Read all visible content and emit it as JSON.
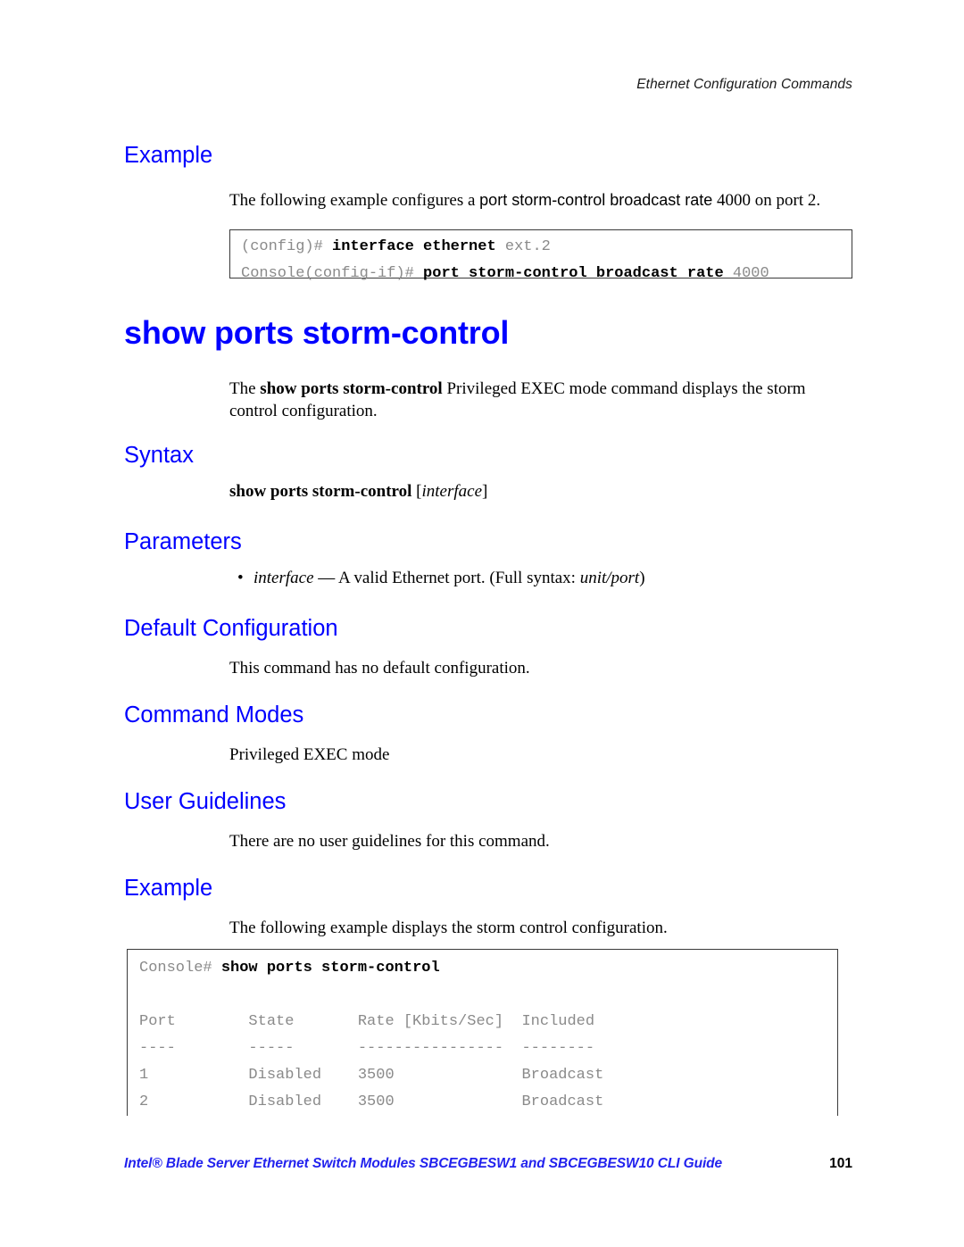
{
  "header": {
    "running_title": "Ethernet Configuration Commands"
  },
  "top_section": {
    "heading": "Example",
    "paragraph_prefix": "The following example configures a ",
    "paragraph_command": "port storm-control broadcast rate",
    "paragraph_suffix": " 4000 on port 2.",
    "code_block": {
      "line1_prompt": "(config)# ",
      "line1_command": "interface ethernet",
      "line1_arg": " ext.2",
      "line2_prompt": "Console(config-if)# ",
      "line2_command": "port storm-control broadcast rate",
      "line2_arg": " 4000"
    }
  },
  "command": {
    "title": "show ports storm-control",
    "description_prefix": "The ",
    "description_bold": "show ports storm-control",
    "description_suffix": " Privileged EXEC mode command displays the storm control configuration."
  },
  "sections": {
    "syntax": {
      "heading": "Syntax",
      "command": "show ports storm-control",
      "optional_open": " [",
      "optional_param": "interface",
      "optional_close": "]"
    },
    "parameters": {
      "heading": "Parameters",
      "bullet_glyph": "•",
      "param_name": "interface",
      "param_dash": " — ",
      "param_desc_a": "A valid Ethernet port. (Full syntax: ",
      "param_desc_italic": "unit/port",
      "param_desc_b": ")"
    },
    "default_configuration": {
      "heading": "Default Configuration",
      "text": "This command has no default configuration."
    },
    "command_modes": {
      "heading": "Command Modes",
      "text": "Privileged EXEC mode"
    },
    "user_guidelines": {
      "heading": "User Guidelines",
      "text": "There are no user guidelines for this command."
    },
    "example": {
      "heading": "Example",
      "text": "The following example displays the storm control configuration."
    }
  },
  "output_block": {
    "prompt": "Console# ",
    "command": "show ports storm-control",
    "blank": "",
    "header_row": "Port        State       Rate [Kbits/Sec]  Included",
    "divider_row": "----        -----       ----------------  --------",
    "rows": [
      "1           Disabled    3500              Broadcast",
      "2           Disabled    3500              Broadcast"
    ]
  },
  "footer": {
    "text": "Intel® Blade Server Ethernet Switch Modules SBCEGBESW1 and SBCEGBESW10 CLI Guide",
    "page_number": "101"
  }
}
